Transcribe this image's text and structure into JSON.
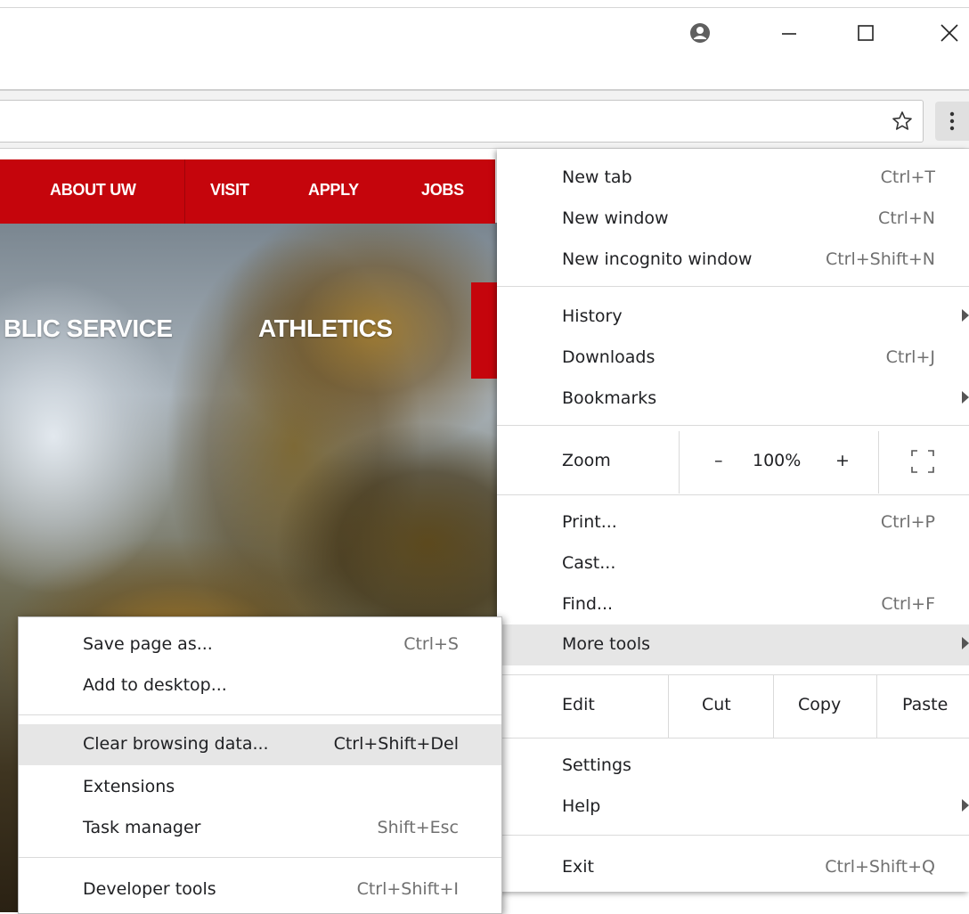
{
  "window": {
    "icons": [
      "account-icon",
      "minimize-icon",
      "maximize-icon",
      "close-icon"
    ]
  },
  "toolbar": {
    "icons": [
      "bookmark-star-icon",
      "menu-dots-icon"
    ]
  },
  "website": {
    "nav": [
      "ABOUT UW",
      "VISIT",
      "APPLY",
      "JOBS"
    ],
    "main_nav": [
      "BLIC SERVICE",
      "ATHLETICS"
    ],
    "brand_color": "#c5050c"
  },
  "menu": {
    "new_tab": {
      "label": "New tab",
      "shortcut": "Ctrl+T"
    },
    "new_window": {
      "label": "New window",
      "shortcut": "Ctrl+N"
    },
    "new_incognito": {
      "label": "New incognito window",
      "shortcut": "Ctrl+Shift+N"
    },
    "history": {
      "label": "History"
    },
    "downloads": {
      "label": "Downloads",
      "shortcut": "Ctrl+J"
    },
    "bookmarks": {
      "label": "Bookmarks"
    },
    "zoom": {
      "label": "Zoom",
      "minus": "–",
      "value": "100%",
      "plus": "+"
    },
    "print": {
      "label": "Print...",
      "shortcut": "Ctrl+P"
    },
    "cast": {
      "label": "Cast..."
    },
    "find": {
      "label": "Find...",
      "shortcut": "Ctrl+F"
    },
    "more_tools": {
      "label": "More tools"
    },
    "edit": {
      "label": "Edit",
      "cut": "Cut",
      "copy": "Copy",
      "paste": "Paste"
    },
    "settings": {
      "label": "Settings"
    },
    "help": {
      "label": "Help"
    },
    "exit": {
      "label": "Exit",
      "shortcut": "Ctrl+Shift+Q"
    }
  },
  "submenu": {
    "save_page": {
      "label": "Save page as...",
      "shortcut": "Ctrl+S"
    },
    "add_desktop": {
      "label": "Add to desktop..."
    },
    "clear_data": {
      "label": "Clear browsing data...",
      "shortcut": "Ctrl+Shift+Del"
    },
    "extensions": {
      "label": "Extensions"
    },
    "task_manager": {
      "label": "Task manager",
      "shortcut": "Shift+Esc"
    },
    "dev_tools": {
      "label": "Developer tools",
      "shortcut": "Ctrl+Shift+I"
    }
  }
}
